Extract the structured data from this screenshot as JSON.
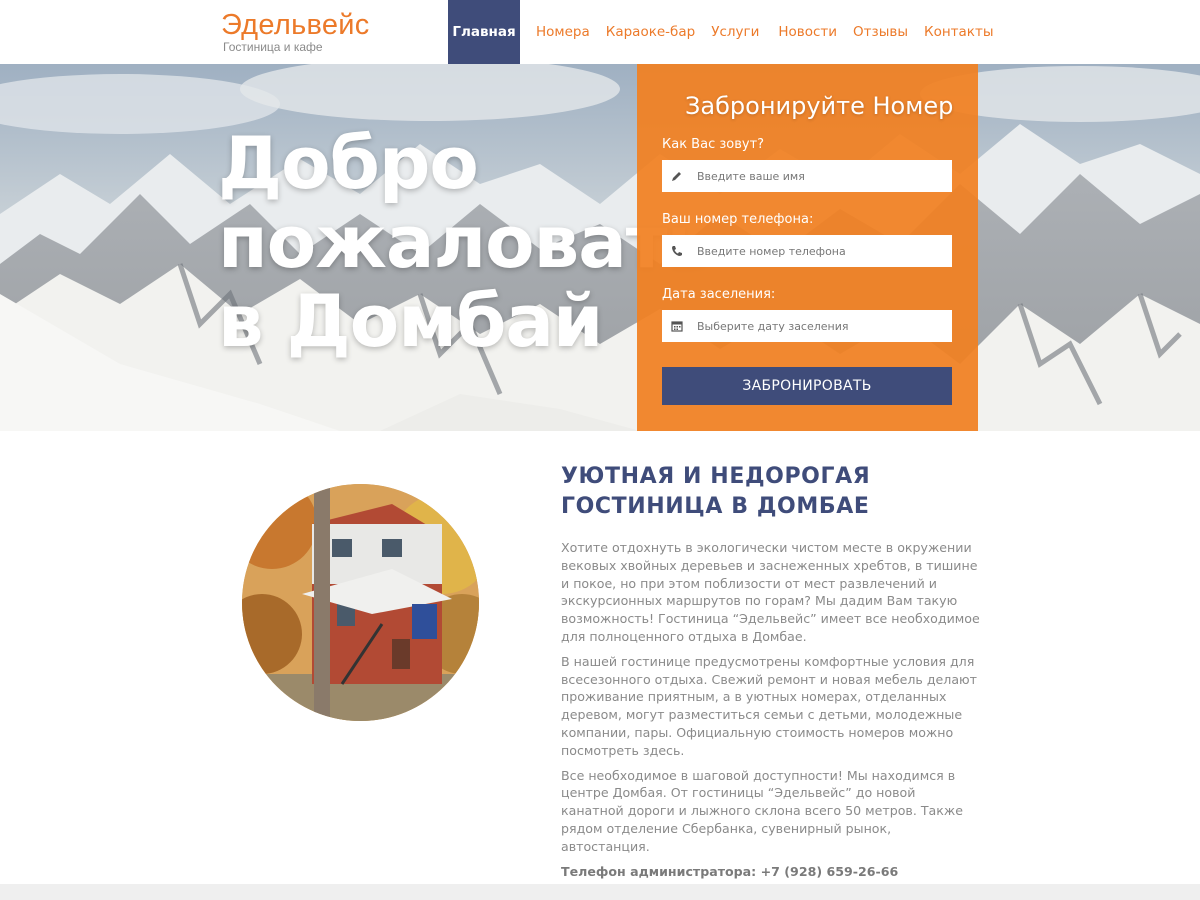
{
  "header": {
    "logo_title": "Эдельвейс",
    "logo_subtitle": "Гостиница и кафе",
    "nav": [
      {
        "label": "Главная",
        "active": true
      },
      {
        "label": "Номера"
      },
      {
        "label": "Караоке-бар"
      },
      {
        "label": "Услуги"
      },
      {
        "label": "Новости"
      },
      {
        "label": "Отзывы"
      },
      {
        "label": "Контакты"
      }
    ]
  },
  "hero": {
    "title_lines": [
      "Добро",
      "пожаловать",
      "в Домбай"
    ]
  },
  "booking": {
    "title": "Забронируйте Номер",
    "name_label": "Как Вас зовут?",
    "name_placeholder": "Введите ваше имя",
    "phone_label": "Ваш номер телефона:",
    "phone_placeholder": "Введите номер телефона",
    "date_label": "Дата заселения:",
    "date_placeholder": "Выберите дату заселения",
    "button": "ЗАБРОНИРОВАТЬ",
    "icons": [
      "pencil-icon",
      "phone-icon",
      "calendar-icon"
    ]
  },
  "about": {
    "heading_line1": "УЮТНАЯ И НЕДОРОГАЯ",
    "heading_line2": "ГОСТИНИЦА В ДОМБАЕ",
    "paragraphs": [
      "Хотите отдохнуть в экологически чистом месте в окружении вековых хвойных деревьев и заснеженных хребтов, в тишине и покое, но при этом поблизости от мест развлечений и экскурсионных маршрутов по горам? Мы дадим Вам такую возможность! Гостиница “Эдельвейс” имеет все необходимое для полноценного отдыха в Домбае.",
      "В нашей гостинице предусмотрены комфортные условия для всесезонного отдыха. Свежий ремонт и новая мебель делают проживание приятным, а в уютных номерах, отделанных деревом, могут разместиться семьи с детьми, молодежные компании, пары. Официальную стоимость номеров можно посмотреть здесь.",
      "Все необходимое в шаговой доступности! Мы находимся в центре Домбая. От гостиницы “Эдельвейс” до новой канатной дороги и лыжного склона всего 50 метров. Также рядом отделение Сбербанка, сувенирный рынок, автостанция."
    ],
    "phone": "Телефон администратора: +7 (928) 659-26-66"
  },
  "colors": {
    "accent": "#ec7a2a",
    "booking_bg": "#f18021",
    "navy": "#3f4c7a"
  }
}
